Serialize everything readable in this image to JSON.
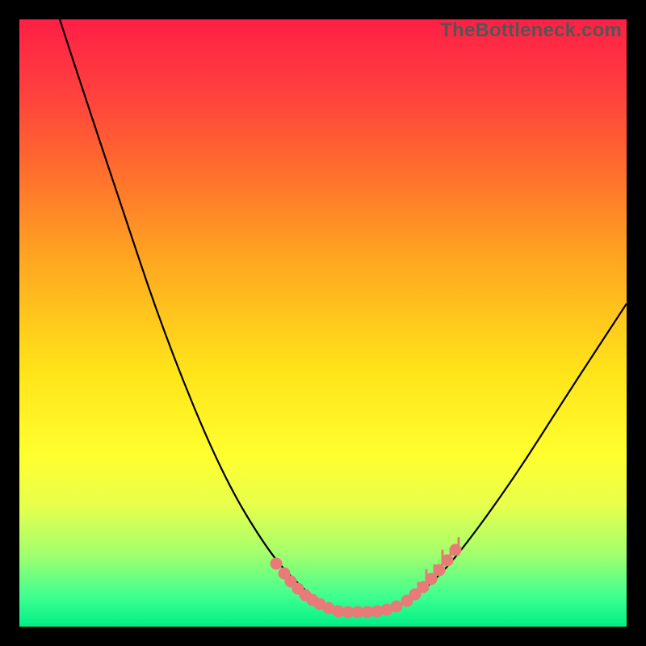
{
  "watermark": {
    "text": "TheBottleneck.com"
  },
  "chart_data": {
    "type": "line",
    "title": "",
    "xlabel": "",
    "ylabel": "",
    "xlim": [
      0,
      752
    ],
    "ylim": [
      0,
      752
    ],
    "grid": false,
    "series": [
      {
        "name": "curve",
        "points": [
          {
            "x": 50,
            "y": 752
          },
          {
            "x": 80,
            "y": 660
          },
          {
            "x": 120,
            "y": 540
          },
          {
            "x": 180,
            "y": 360
          },
          {
            "x": 250,
            "y": 190
          },
          {
            "x": 310,
            "y": 90
          },
          {
            "x": 350,
            "y": 48
          },
          {
            "x": 378,
            "y": 26
          },
          {
            "x": 408,
            "y": 18
          },
          {
            "x": 440,
            "y": 18
          },
          {
            "x": 472,
            "y": 26
          },
          {
            "x": 500,
            "y": 44
          },
          {
            "x": 540,
            "y": 84
          },
          {
            "x": 610,
            "y": 180
          },
          {
            "x": 680,
            "y": 290
          },
          {
            "x": 752,
            "y": 400
          }
        ]
      }
    ],
    "scatter_clusters": [
      {
        "name": "left-cluster",
        "color": "#e87a78",
        "points": [
          {
            "x": 318,
            "y": 78
          },
          {
            "x": 328,
            "y": 66
          },
          {
            "x": 336,
            "y": 56
          },
          {
            "x": 345,
            "y": 47
          },
          {
            "x": 354,
            "y": 39
          },
          {
            "x": 363,
            "y": 33
          },
          {
            "x": 372,
            "y": 28
          },
          {
            "x": 383,
            "y": 23
          }
        ]
      },
      {
        "name": "bottom-cluster",
        "color": "#e87a78",
        "points": [
          {
            "x": 395,
            "y": 19
          },
          {
            "x": 407,
            "y": 18
          },
          {
            "x": 419,
            "y": 18
          },
          {
            "x": 431,
            "y": 18
          },
          {
            "x": 443,
            "y": 19
          },
          {
            "x": 455,
            "y": 21
          },
          {
            "x": 467,
            "y": 25
          }
        ]
      },
      {
        "name": "right-cluster",
        "color": "#e87a78",
        "points": [
          {
            "x": 480,
            "y": 32
          },
          {
            "x": 490,
            "y": 40
          },
          {
            "x": 500,
            "y": 49
          },
          {
            "x": 510,
            "y": 59
          },
          {
            "x": 520,
            "y": 70
          },
          {
            "x": 530,
            "y": 82
          },
          {
            "x": 540,
            "y": 95
          }
        ]
      }
    ],
    "right_ticks": {
      "color": "#e87a78",
      "ticks": [
        {
          "x": 494,
          "len": 14
        },
        {
          "x": 504,
          "len": 22
        },
        {
          "x": 514,
          "len": 18
        },
        {
          "x": 524,
          "len": 26
        },
        {
          "x": 534,
          "len": 16
        },
        {
          "x": 544,
          "len": 20
        }
      ]
    }
  }
}
